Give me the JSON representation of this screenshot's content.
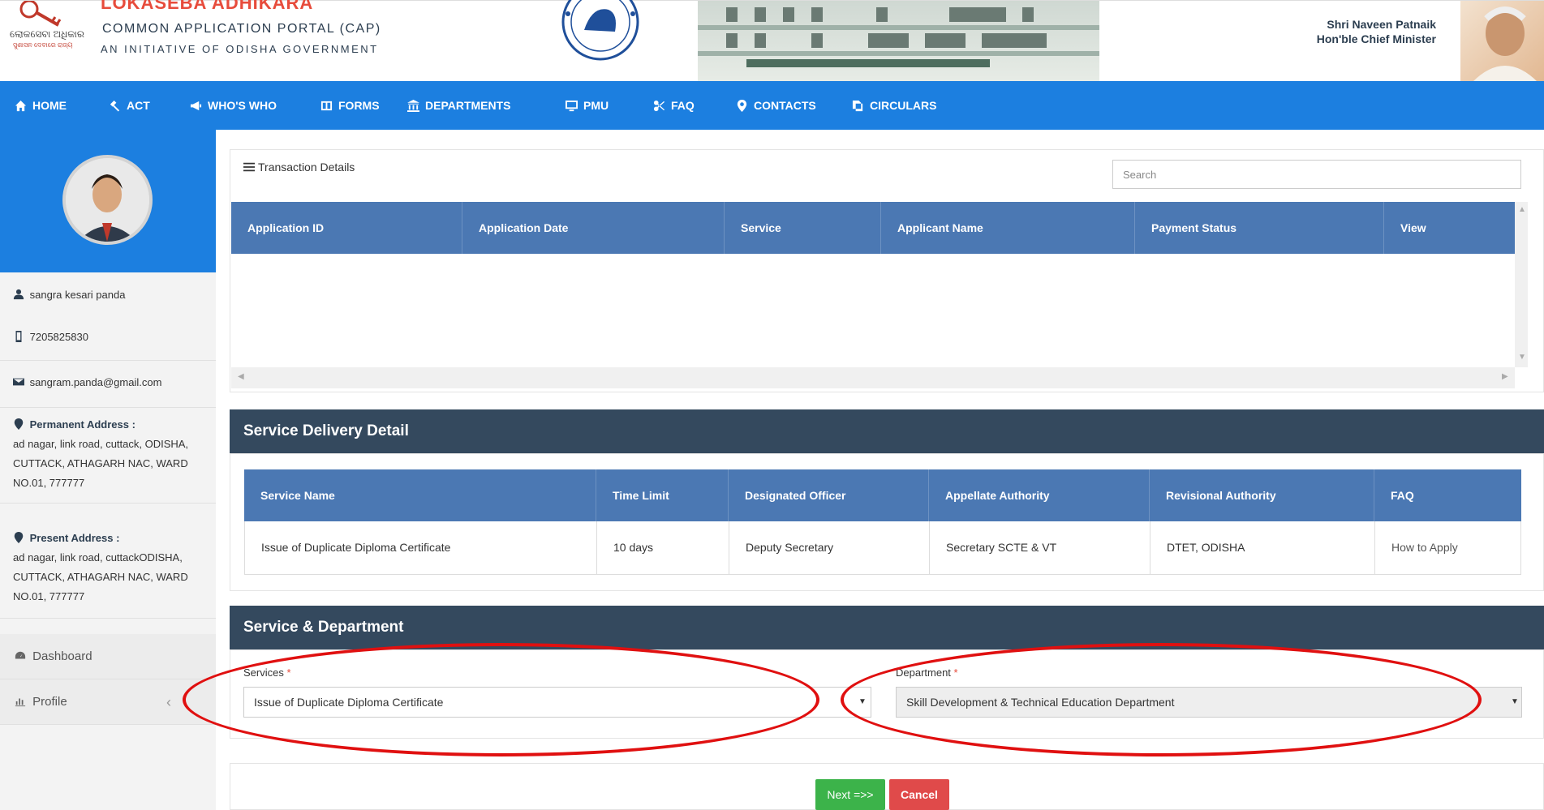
{
  "header": {
    "brand_top": "LOKASEBA ADHIKARA",
    "brand_title": "COMMON APPLICATION PORTAL (CAP)",
    "brand_subtitle": "AN INITIATIVE OF ODISHA GOVERNMENT",
    "logo_odia": "ଲୋକସେବା ଅଧିକାର",
    "logo_odia_sub": "ସୁଶାସନ ଦେବାରେ ରାଜ୍ୟ",
    "cm_name": "Shri Naveen Patnaik",
    "cm_title": "Hon'ble Chief Minister"
  },
  "nav": {
    "items": [
      {
        "label": "HOME",
        "icon": "home-icon"
      },
      {
        "label": "ACT",
        "icon": "gavel-icon"
      },
      {
        "label": "WHO'S WHO",
        "icon": "megaphone-icon"
      },
      {
        "label": "FORMS",
        "icon": "columns-icon"
      },
      {
        "label": "DEPARTMENTS",
        "icon": "bank-icon"
      },
      {
        "label": "PMU",
        "icon": "monitor-icon"
      },
      {
        "label": "FAQ",
        "icon": "scissors-icon"
      },
      {
        "label": "CONTACTS",
        "icon": "map-marker-icon"
      },
      {
        "label": "CIRCULARS",
        "icon": "copy-icon"
      }
    ]
  },
  "profile": {
    "name": "sangra kesari panda",
    "phone": "7205825830",
    "email": "sangram.panda@gmail.com",
    "permanent_label": "Permanent Address :",
    "permanent_address": "ad nagar, link road, cuttack, ODISHA, CUTTACK, ATHAGARH NAC, WARD NO.01, 777777",
    "present_label": "Present Address :",
    "present_address": "ad nagar, link road, cuttackODISHA, CUTTACK, ATHAGARH NAC, WARD NO.01, 777777"
  },
  "sidebar_menu": {
    "dashboard": "Dashboard",
    "profile": "Profile",
    "collapse": "‹"
  },
  "transactions": {
    "title": "Transaction Details",
    "search_placeholder": "Search",
    "columns": [
      "Application ID",
      "Application Date",
      "Service",
      "Applicant Name",
      "Payment Status",
      "View"
    ]
  },
  "service_delivery": {
    "title": "Service Delivery Detail",
    "columns": [
      "Service Name",
      "Time Limit",
      "Designated Officer",
      "Appellate Authority",
      "Revisional Authority",
      "FAQ"
    ],
    "row": [
      "Issue of Duplicate Diploma Certificate",
      "10 days",
      "Deputy Secretary",
      "Secretary SCTE & VT",
      "DTET, ODISHA",
      "How to Apply"
    ]
  },
  "service_department": {
    "title": "Service & Department",
    "services_label": "Services",
    "services_value": "Issue of Duplicate Diploma Certificate",
    "department_label": "Department",
    "department_value": "Skill Development & Technical Education Department",
    "required_mark": "*"
  },
  "actions": {
    "next": "Next =>>",
    "cancel": "Cancel"
  },
  "colors": {
    "nav_blue": "#1c7fe0",
    "table_header": "#4b78b3",
    "section_bar": "#34495e",
    "next_green": "#3cb34a",
    "cancel_red": "#e04a4a",
    "annotation_red": "#e01010"
  }
}
